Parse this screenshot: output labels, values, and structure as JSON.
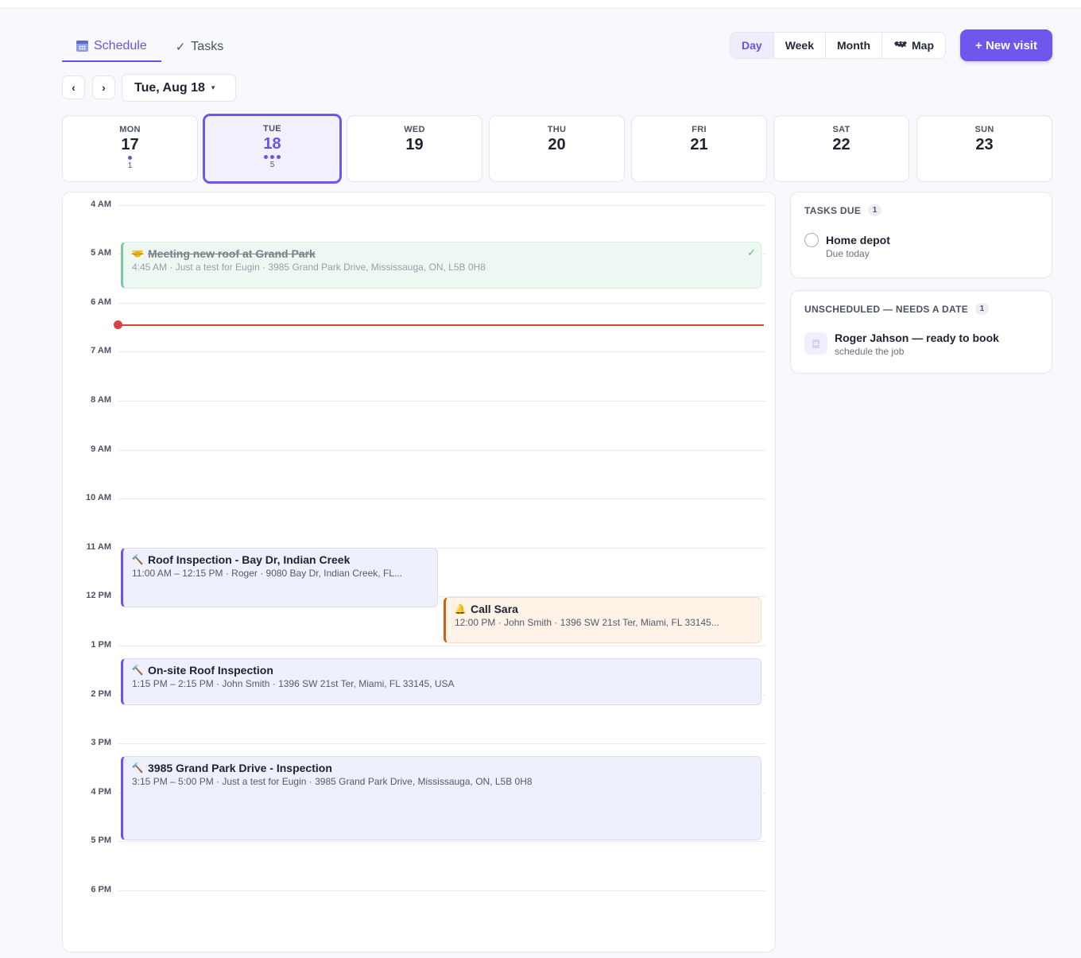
{
  "tabs": [
    {
      "label": "Schedule",
      "icon": "calendar-icon",
      "active": true
    },
    {
      "label": "Tasks",
      "icon": "check-icon",
      "active": false
    }
  ],
  "tasks_check_glyph": "✓",
  "views": [
    {
      "label": "Day",
      "active": true
    },
    {
      "label": "Week"
    },
    {
      "label": "Month"
    },
    {
      "label": "Map",
      "icon": "map-icon"
    }
  ],
  "new_visit_label": "+ New visit",
  "nav": {
    "prev": "‹",
    "next": "›",
    "current_date": "Tue, Aug 18",
    "caret": "▾"
  },
  "week": [
    {
      "dow": "MON",
      "num": "17",
      "dots": 1,
      "count": "1"
    },
    {
      "dow": "TUE",
      "num": "18",
      "dots": 3,
      "count": "5",
      "active": true
    },
    {
      "dow": "WED",
      "num": "19",
      "dots": 0,
      "count": ""
    },
    {
      "dow": "THU",
      "num": "20",
      "dots": 0,
      "count": ""
    },
    {
      "dow": "FRI",
      "num": "21",
      "dots": 0,
      "count": ""
    },
    {
      "dow": "SAT",
      "num": "22",
      "dots": 0,
      "count": ""
    },
    {
      "dow": "SUN",
      "num": "23",
      "dots": 0,
      "count": ""
    }
  ],
  "hours": [
    "4 AM",
    "5 AM",
    "6 AM",
    "7 AM",
    "8 AM",
    "9 AM",
    "10 AM",
    "11 AM",
    "12 PM",
    "1 PM",
    "2 PM",
    "3 PM",
    "4 PM",
    "5 PM",
    "6 PM"
  ],
  "events": {
    "meeting": {
      "icon": "handshake-icon",
      "title": "Meeting new roof at Grand Park",
      "meta": "4:45 AM · Just a test for Eugin · 3985 Grand Park Drive, Mississauga, ON, L5B 0H8",
      "check": "✓"
    },
    "roof_bay": {
      "icon": "hammer-icon",
      "title": "Roof Inspection - Bay Dr, Indian Creek",
      "meta": "11:00 AM – 12:15 PM · Roger · 9080 Bay Dr, Indian Creek, FL..."
    },
    "call_sara": {
      "icon": "bell-icon",
      "title": "Call Sara",
      "meta": "12:00 PM · John Smith · 1396 SW 21st Ter, Miami, FL 33145..."
    },
    "onsite": {
      "icon": "hammer-icon",
      "title": "On-site Roof Inspection",
      "meta": "1:15 PM – 2:15 PM · John Smith · 1396 SW 21st Ter, Miami, FL 33145, USA"
    },
    "grand_park": {
      "icon": "hammer-icon",
      "title": "3985 Grand Park Drive - Inspection",
      "meta": "3:15 PM – 5:00 PM · Just a test for Eugin · 3985 Grand Park Drive, Mississauga, ON, L5B 0H8"
    }
  },
  "tasks_due": {
    "heading": "TASKS DUE",
    "count": "1",
    "item": {
      "title": "Home depot",
      "sub": "Due today"
    }
  },
  "unscheduled": {
    "heading": "UNSCHEDULED — NEEDS A DATE",
    "count": "1",
    "item": {
      "title": "Roger Jahson — ready to book",
      "sub": "schedule the job"
    }
  },
  "colors": {
    "accent": "#6f56ec",
    "now_line": "#d64545",
    "done": "#7ac9a3",
    "call": "#c9611b"
  }
}
